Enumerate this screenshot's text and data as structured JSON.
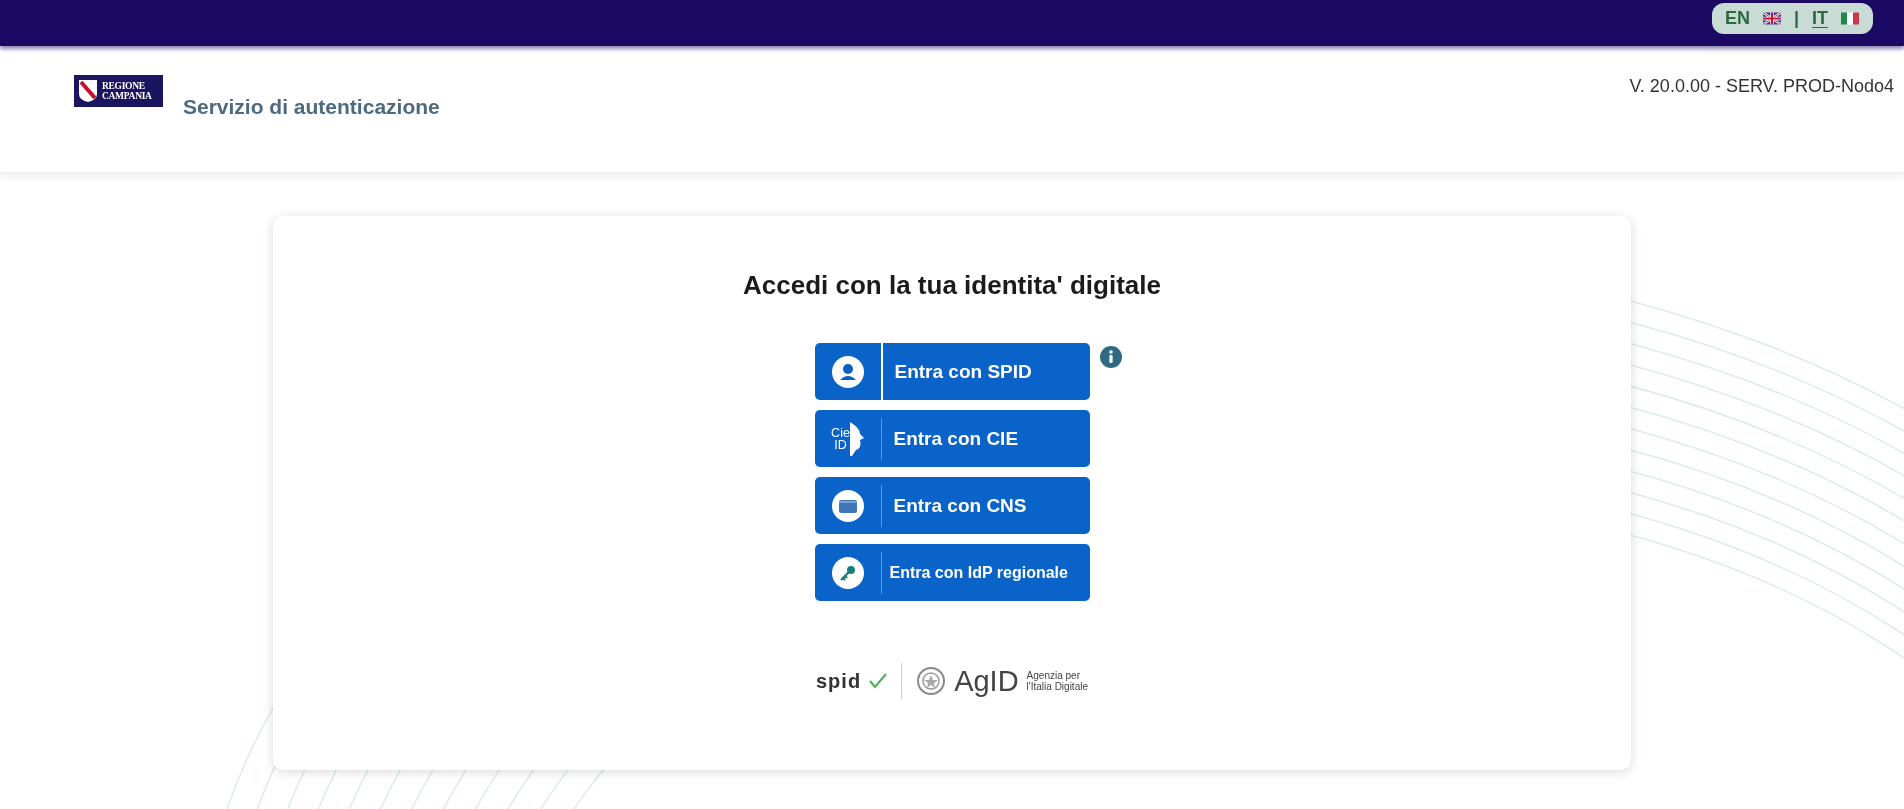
{
  "top_bar": {
    "languages": [
      {
        "label": "EN",
        "kind": "uk",
        "selected": false
      },
      {
        "label": "IT",
        "kind": "it",
        "selected": true
      }
    ],
    "separator": "|"
  },
  "header": {
    "logo_lines": [
      "REGIONE",
      "CAMPANIA"
    ],
    "title": "Servizio di autenticazione",
    "version": "V. 20.0.00 - SERV. PROD-Nodo4"
  },
  "card": {
    "title": "Accedi con la tua identita' digitale",
    "buttons": [
      {
        "kind": "user",
        "label": "Entra con SPID",
        "info": true
      },
      {
        "kind": "cie",
        "label": "Entra con CIE",
        "badge": [
          "Cie",
          "ID"
        ],
        "info": false
      },
      {
        "kind": "card",
        "label": "Entra con CNS",
        "info": false
      },
      {
        "kind": "key",
        "label": "Entra con IdP regionale",
        "info": false
      }
    ],
    "footer": {
      "spid": "spid",
      "agid": "AgID",
      "agid_caption": [
        "Agenzia per",
        "l'Italia Digitale"
      ]
    }
  }
}
